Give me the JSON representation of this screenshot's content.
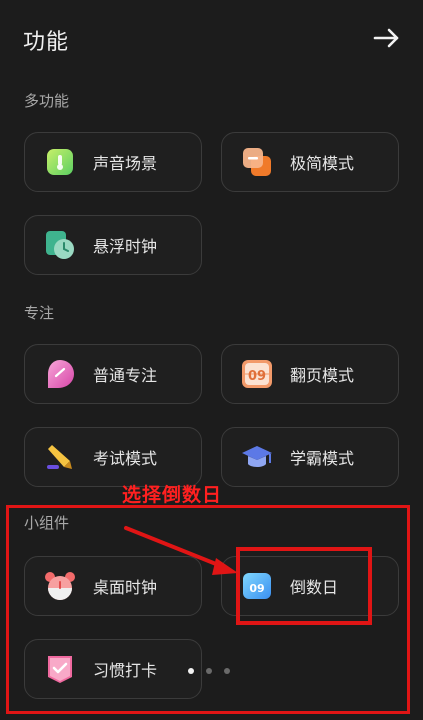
{
  "header": {
    "title": "功能",
    "back_icon": "arrow-right-icon"
  },
  "sections": {
    "multi": {
      "label": "多功能",
      "items": [
        {
          "label": "声音场景",
          "icon": "sound-scene-icon"
        },
        {
          "label": "极简模式",
          "icon": "minimal-mode-icon"
        },
        {
          "label": "悬浮时钟",
          "icon": "floating-clock-icon"
        }
      ]
    },
    "focus": {
      "label": "专注",
      "items": [
        {
          "label": "普通专注",
          "icon": "normal-focus-icon"
        },
        {
          "label": "翻页模式",
          "icon": "flip-mode-icon",
          "icon_text": "09"
        },
        {
          "label": "考试模式",
          "icon": "exam-pen-icon"
        },
        {
          "label": "学霸模式",
          "icon": "graduation-cap-icon"
        }
      ]
    },
    "widgets": {
      "label": "小组件",
      "items": [
        {
          "label": "桌面时钟",
          "icon": "alarm-clock-icon"
        },
        {
          "label": "倒数日",
          "icon": "countdown-day-icon",
          "icon_text": "09"
        },
        {
          "label": "习惯打卡",
          "icon": "habit-checkin-icon"
        }
      ]
    }
  },
  "pager": {
    "total": 3,
    "active_index": 0
  },
  "annotation": {
    "text": "选择倒数日",
    "color": "#ff2020"
  },
  "colors": {
    "background": "#1c1c1c",
    "card_border": "#3b3b3b",
    "annotation_red": "#e01515"
  }
}
